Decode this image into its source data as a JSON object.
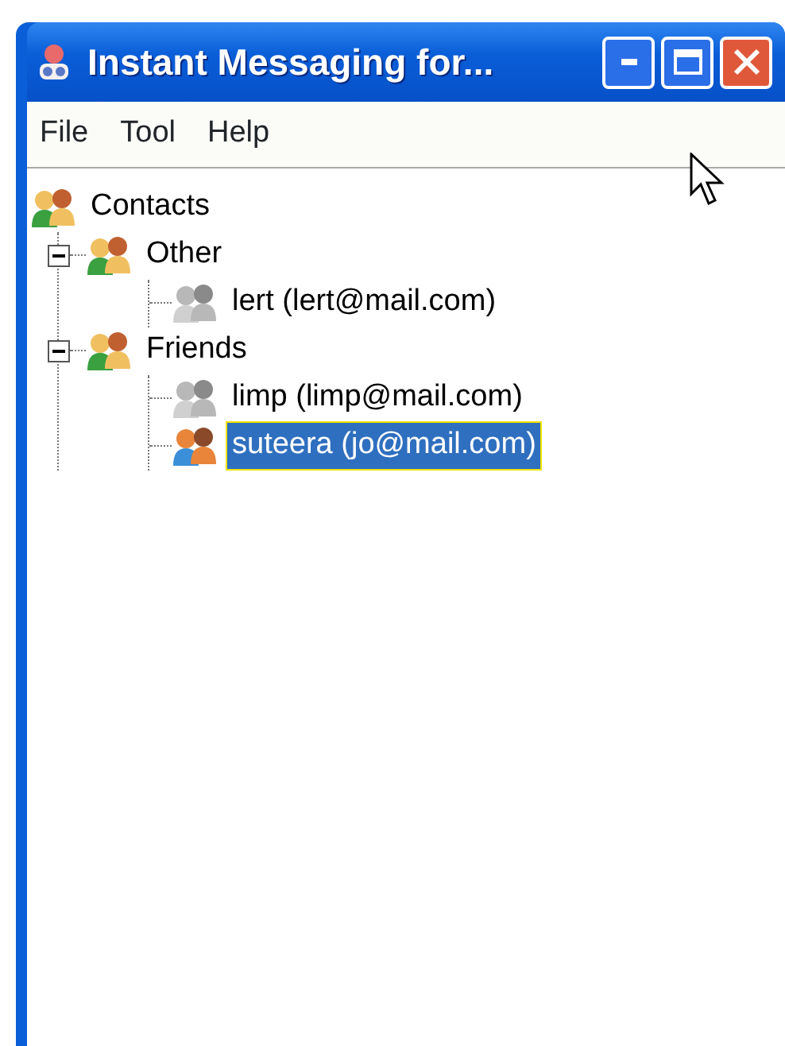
{
  "window": {
    "title": "Instant Messaging for..."
  },
  "menu": [
    "File",
    "Tool",
    "Help"
  ],
  "tree": {
    "label": "Contacts",
    "children": [
      {
        "label": "Other",
        "expanded": true,
        "children": [
          {
            "label": "lert (lert@mail.com)",
            "online": false,
            "selected": false
          }
        ]
      },
      {
        "label": "Friends",
        "expanded": true,
        "children": [
          {
            "label": "limp (limp@mail.com)",
            "online": false,
            "selected": false
          },
          {
            "label": "suteera (jo@mail.com)",
            "online": true,
            "selected": true
          }
        ]
      }
    ]
  }
}
